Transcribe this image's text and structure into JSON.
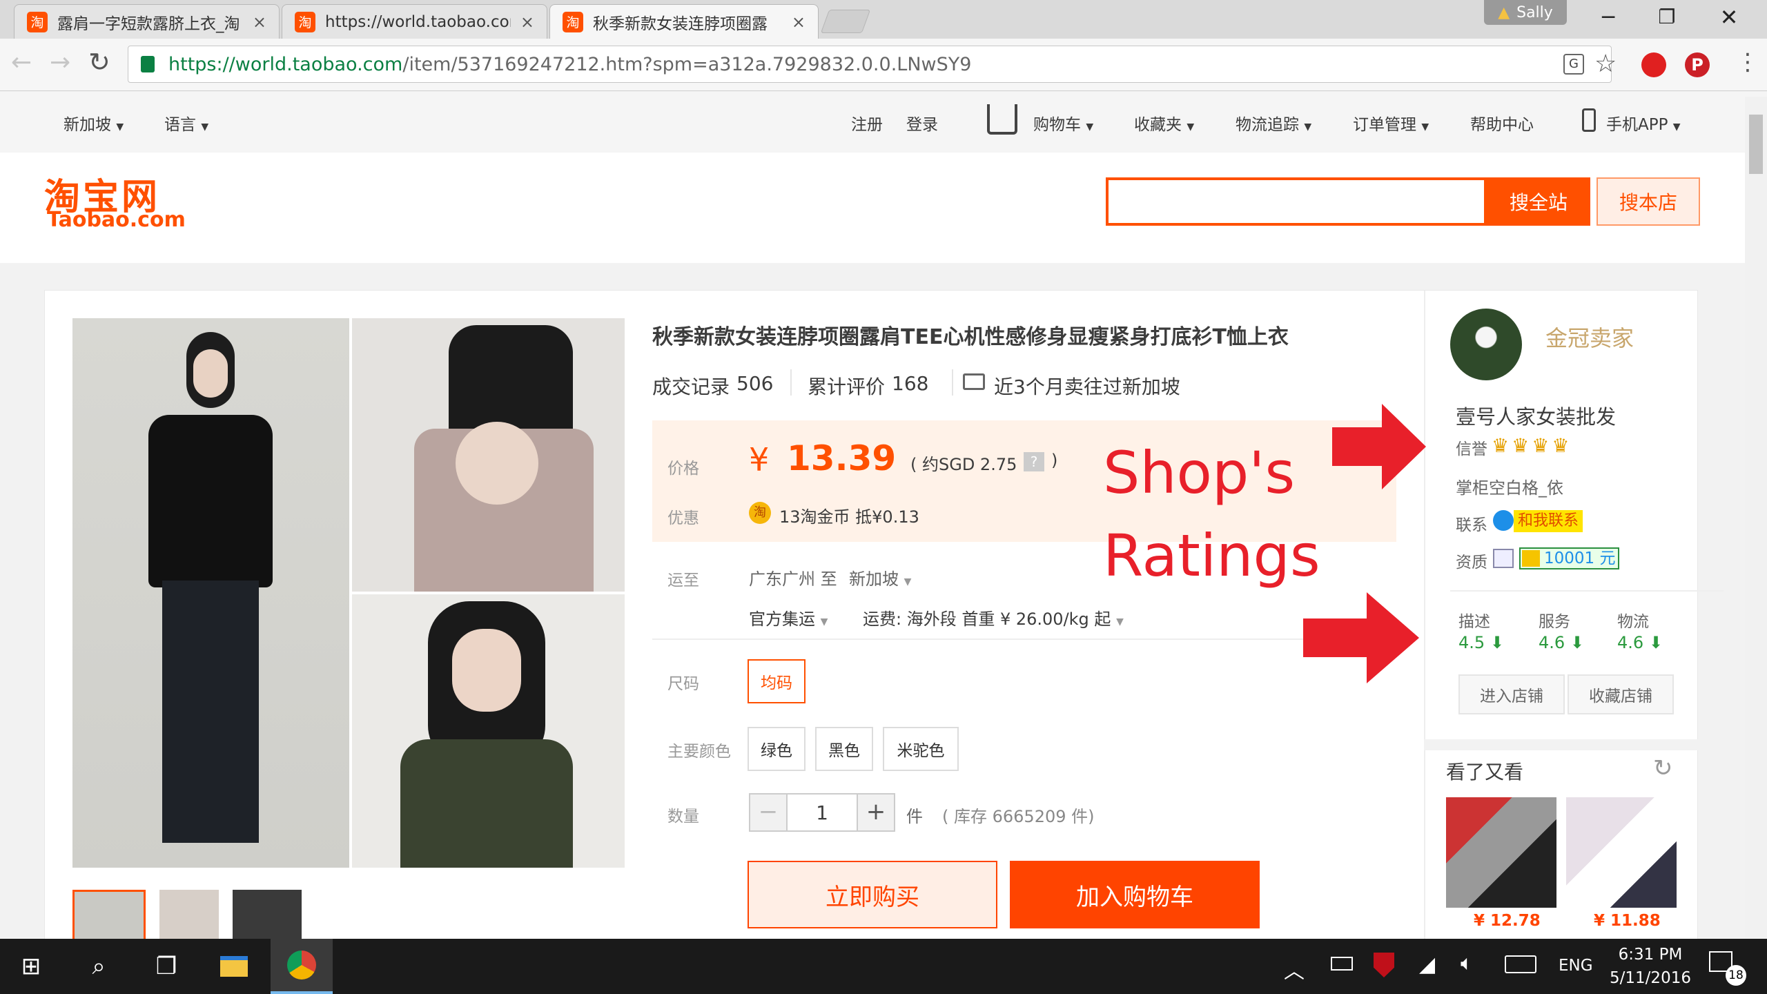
{
  "browser": {
    "tabs": [
      {
        "title": "露肩一字短款露脐上衣_淘",
        "favicon": "淘",
        "close": "×"
      },
      {
        "title": "https://world.taobao.com",
        "favicon": "淘",
        "close": "×"
      },
      {
        "title": "秋季新款女装连脖项圈露",
        "favicon": "淘",
        "close": "×"
      }
    ],
    "profile": "Sally",
    "url": {
      "host": "https://world.taobao.com",
      "path": "/item/537169247212.htm?spm=a312a.7929832.0.0.LNwSY9"
    }
  },
  "topnav": {
    "region": "新加坡",
    "language": "语言",
    "register": "注册",
    "login": "登录",
    "cart": "购物车",
    "favorites": "收藏夹",
    "logistics": "物流追踪",
    "orders": "订单管理",
    "help": "帮助中心",
    "app": "手机APP"
  },
  "header": {
    "logo_cn": "淘宝网",
    "logo_en": "Taobao.com",
    "search_all": "搜全站",
    "search_shop": "搜本店"
  },
  "product": {
    "title": "秋季新款女装连脖项圈露肩TEE心机性感修身显瘦紧身打底衫T恤上衣",
    "sales_label": "成交记录",
    "sales": "506",
    "reviews_label": "累计评价",
    "reviews": "168",
    "shipped_note": "近3个月卖往过新加坡",
    "price_label": "价格",
    "currency": "¥",
    "price": "13.39",
    "price_sgd": "( 约SGD 2.75",
    "help": "?",
    "price_sgd_close": ")",
    "promo_label": "优惠",
    "promo_icon": "淘",
    "promo_text": "13淘金币 抵¥0.13",
    "ship_label": "运至",
    "ship_from": "广东广州 至",
    "ship_to": "新加坡",
    "ship_method": "官方集运",
    "ship_fee": "运费: 海外段 首重 ¥ 26.00/kg 起",
    "size_label": "尺码",
    "sizes": [
      "均码"
    ],
    "color_label": "主要颜色",
    "colors": [
      "绿色",
      "黑色",
      "米驼色"
    ],
    "qty_label": "数量",
    "qty": "1",
    "qty_unit": "件",
    "stock": "( 库存 6665209 件)",
    "buy_now": "立即购买",
    "add_cart": "加入购物车"
  },
  "annotation": {
    "line1": "Shop's",
    "line2": "Ratings"
  },
  "shop": {
    "badge": "金冠卖家",
    "name": "壹号人家女装批发",
    "credit_label": "信誉",
    "crowns": 4,
    "keeper": "掌柜空白格_依",
    "contact_label": "联系",
    "contact_btn": "和我联系",
    "qual_label": "资质",
    "deposit": "10001 元",
    "ratings": [
      {
        "label": "描述",
        "value": "4.5"
      },
      {
        "label": "服务",
        "value": "4.6"
      },
      {
        "label": "物流",
        "value": "4.6"
      }
    ],
    "enter": "进入店铺",
    "collect": "收藏店铺",
    "also_viewed": "看了又看",
    "rec_prices": [
      "¥ 12.78",
      "¥ 11.88"
    ]
  },
  "taskbar": {
    "lang": "ENG",
    "time": "6:31 PM",
    "date": "5/11/2016",
    "notif": "18"
  },
  "colors": {
    "accent": "#ff5000",
    "red_arrow": "#e8202a",
    "rating_green": "#2b9a3e"
  }
}
